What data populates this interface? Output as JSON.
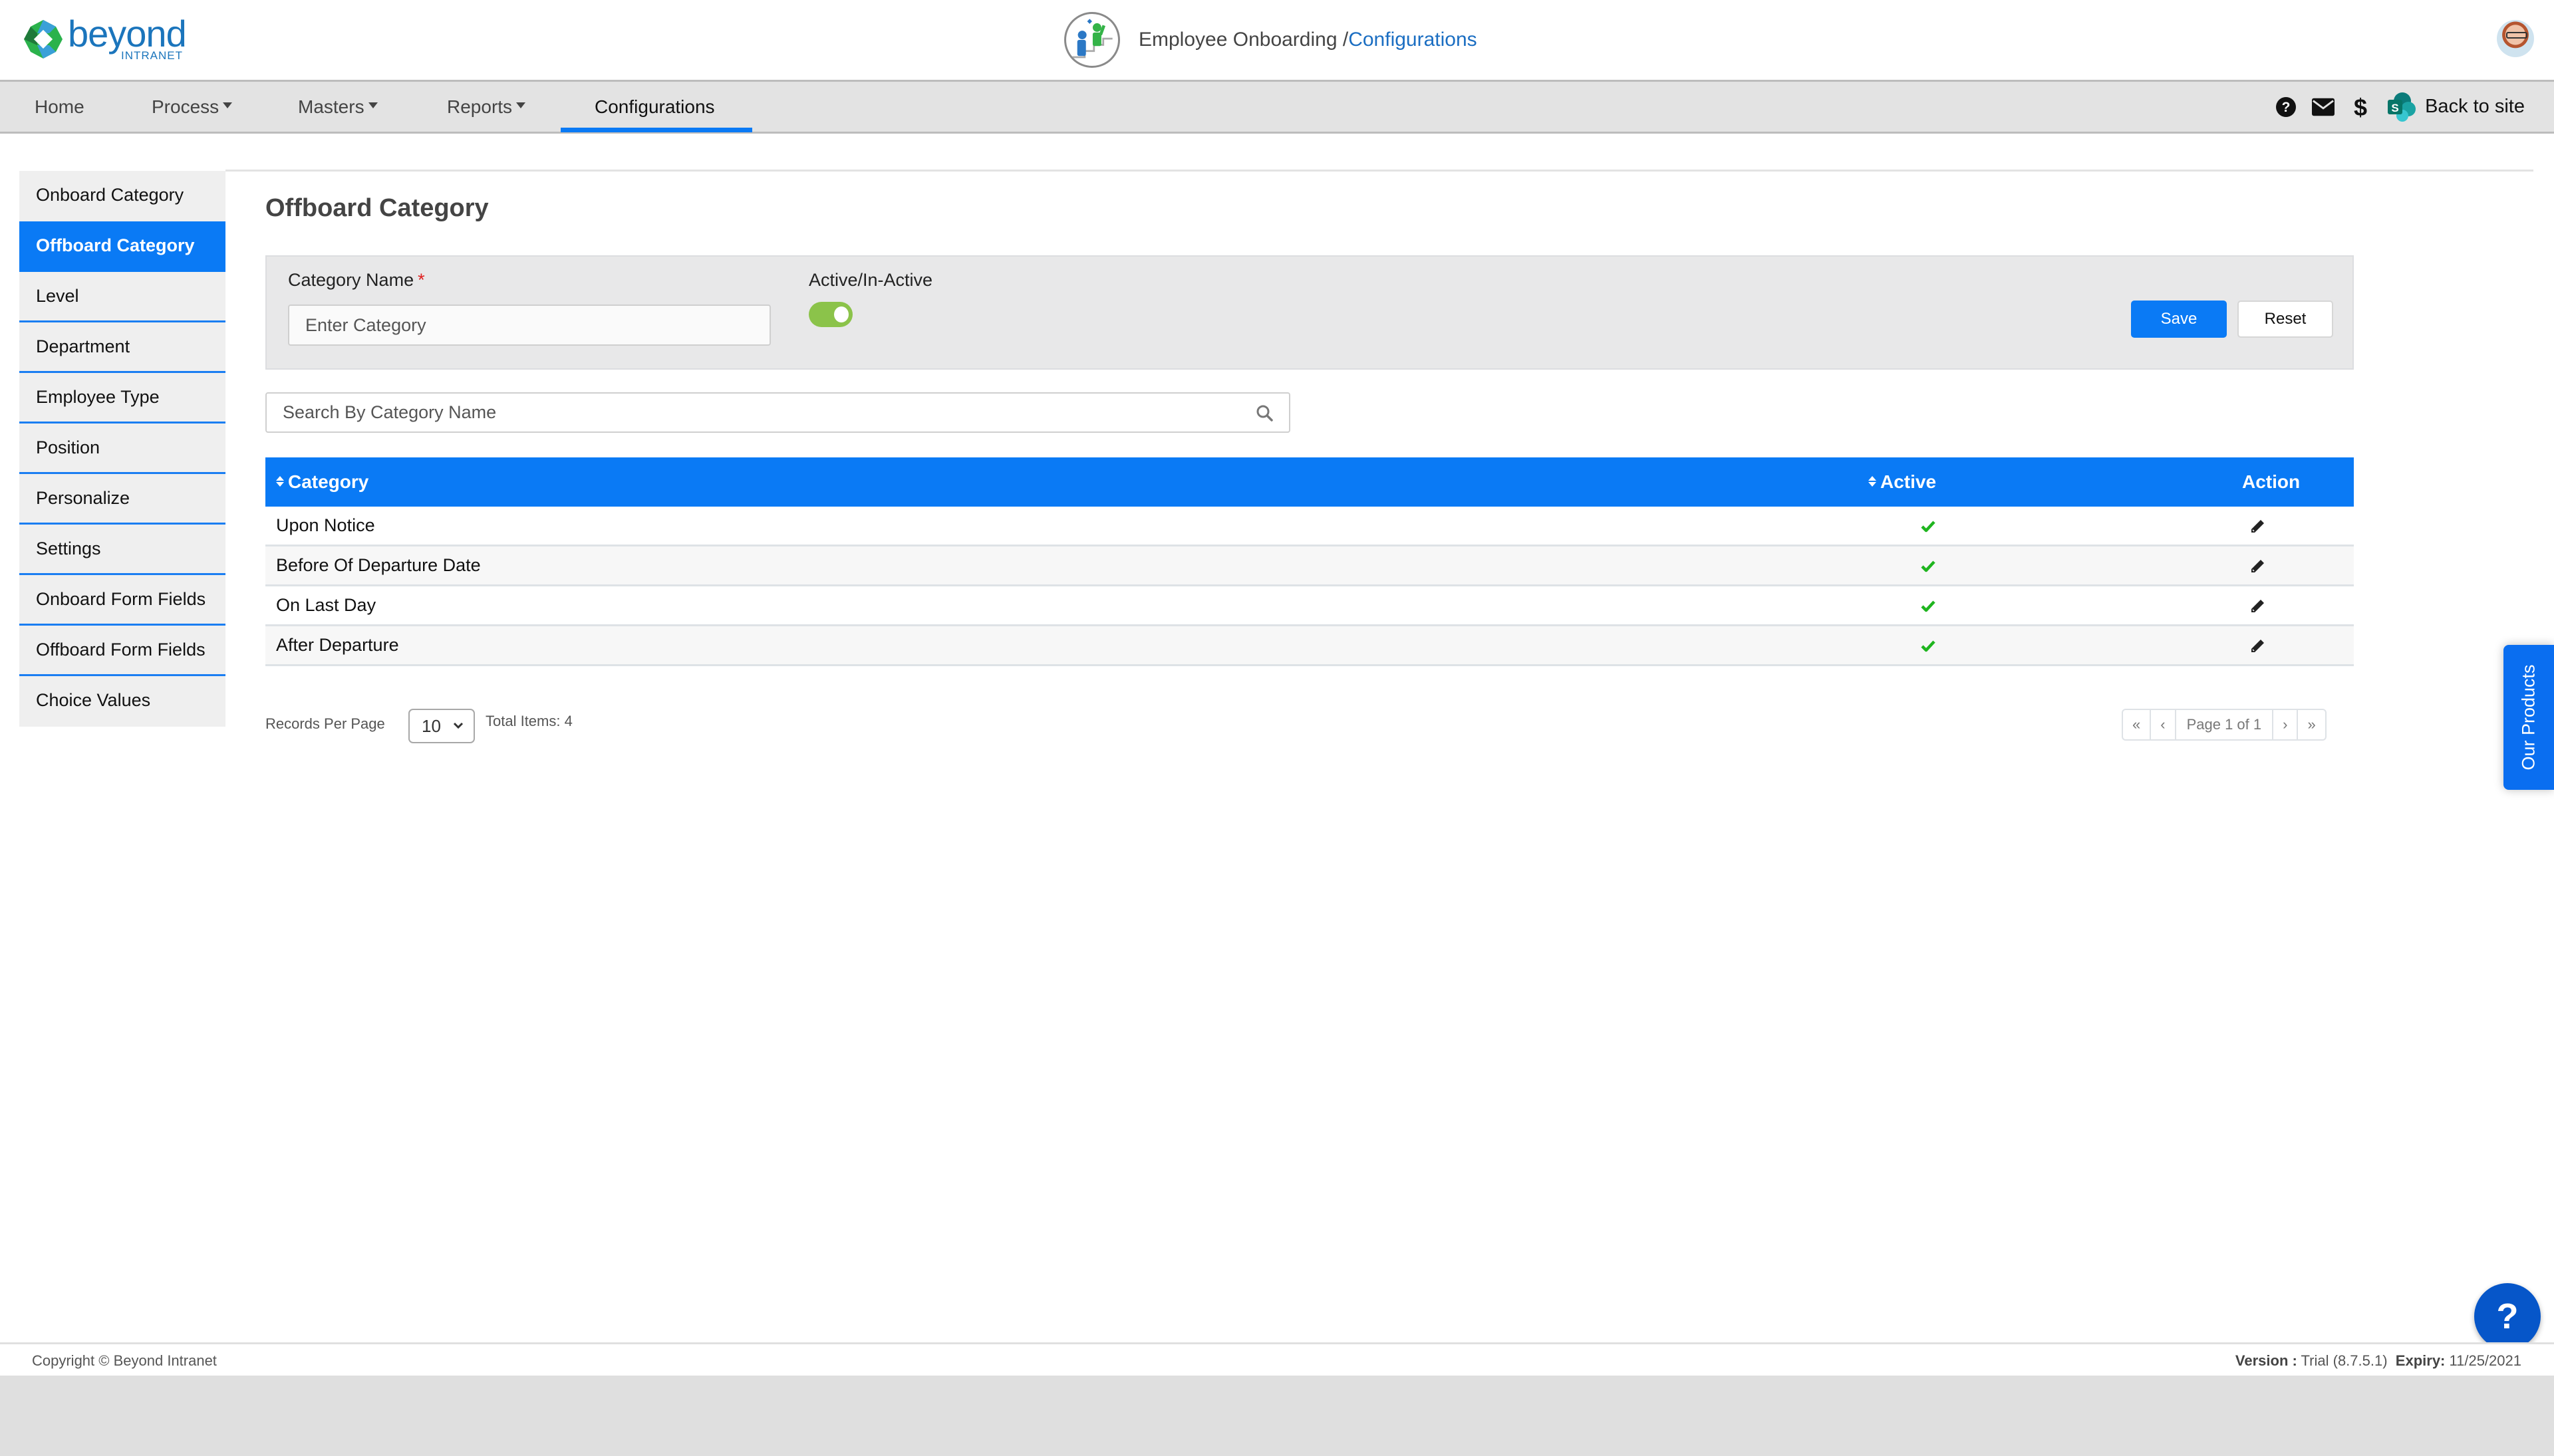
{
  "brand": {
    "name": "beyond",
    "sub": "INTRANET"
  },
  "header": {
    "app_title": "Employee Onboarding /",
    "crumb": "Configurations"
  },
  "nav": {
    "items": [
      {
        "label": "Home",
        "dropdown": false
      },
      {
        "label": "Process",
        "dropdown": true
      },
      {
        "label": "Masters",
        "dropdown": true
      },
      {
        "label": "Reports",
        "dropdown": true
      },
      {
        "label": "Configurations",
        "dropdown": false,
        "active": true
      }
    ],
    "right": {
      "icons": [
        "help-circle-icon",
        "envelope-icon",
        "dollar-icon",
        "sharepoint-icon"
      ],
      "back_label": "Back to site"
    }
  },
  "sidebar": {
    "items": [
      {
        "label": "Onboard Category"
      },
      {
        "label": "Offboard Category",
        "active": true
      },
      {
        "label": "Level"
      },
      {
        "label": "Department"
      },
      {
        "label": "Employee Type"
      },
      {
        "label": "Position"
      },
      {
        "label": "Personalize"
      },
      {
        "label": "Settings"
      },
      {
        "label": "Onboard Form Fields"
      },
      {
        "label": "Offboard Form Fields"
      },
      {
        "label": "Choice Values"
      }
    ]
  },
  "page": {
    "title": "Offboard Category",
    "form": {
      "category_label": "Category Name",
      "required_mark": "*",
      "category_placeholder": "Enter Category",
      "category_value": "",
      "active_label": "Active/In-Active",
      "active_on": true,
      "save_label": "Save",
      "reset_label": "Reset"
    },
    "search": {
      "placeholder": "Search By Category Name",
      "value": ""
    },
    "table": {
      "columns": [
        "Category",
        "Active",
        "Action"
      ],
      "rows": [
        {
          "category": "Upon Notice",
          "active": true
        },
        {
          "category": "Before Of Departure Date",
          "active": true
        },
        {
          "category": "On Last Day",
          "active": true
        },
        {
          "category": "After Departure",
          "active": true
        }
      ]
    },
    "pagination": {
      "records_label": "Records Per Page",
      "per_page": "10",
      "total_label": "Total Items: 4",
      "page_info": "Page 1 of 1",
      "first": "«",
      "prev": "‹",
      "next": "›",
      "last": "»"
    }
  },
  "floating": {
    "our_products": "Our Products",
    "help": "?"
  },
  "footer": {
    "copyright": "Copyright © Beyond Intranet",
    "version_label": "Version :",
    "version_value": "Trial (8.7.5.1)",
    "expiry_label": "Expiry:",
    "expiry_value": "11/25/2021"
  },
  "colors": {
    "primary": "#0a7af5",
    "toggle_on": "#8bc34a",
    "check": "#1fb51f",
    "crumb": "#1b6ec2"
  }
}
